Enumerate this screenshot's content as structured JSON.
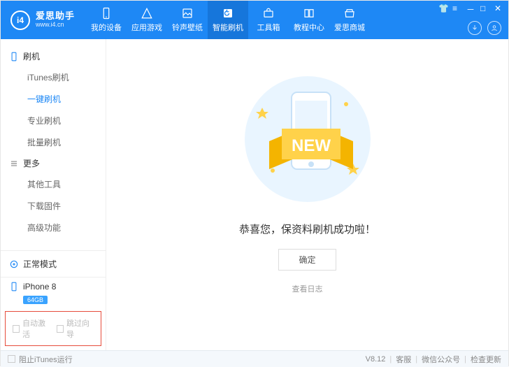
{
  "brand": {
    "name": "爱思助手",
    "url": "www.i4.cn",
    "badge": "i4"
  },
  "nav": {
    "items": [
      {
        "label": "我的设备"
      },
      {
        "label": "应用游戏"
      },
      {
        "label": "铃声壁纸"
      },
      {
        "label": "智能刷机"
      },
      {
        "label": "工具箱"
      },
      {
        "label": "教程中心"
      },
      {
        "label": "爱思商城"
      }
    ]
  },
  "sidebar": {
    "groups": [
      {
        "title": "刷机",
        "items": [
          "iTunes刷机",
          "一键刷机",
          "专业刷机",
          "批量刷机"
        ],
        "active_index": 1
      },
      {
        "title": "更多",
        "items": [
          "其他工具",
          "下载固件",
          "高级功能"
        ],
        "active_index": -1
      }
    ],
    "mode": "正常模式",
    "device": {
      "name": "iPhone 8",
      "capacity": "64GB"
    },
    "checks": {
      "auto_activate": "自动激活",
      "skip_wizard": "跳过向导"
    }
  },
  "main": {
    "banner_text": "NEW",
    "message": "恭喜您，保资料刷机成功啦！",
    "confirm": "确定",
    "view_log": "查看日志"
  },
  "footer": {
    "block_itunes": "阻止iTunes运行",
    "version": "V8.12",
    "support": "客服",
    "wechat": "微信公众号",
    "check_update": "检查更新"
  }
}
